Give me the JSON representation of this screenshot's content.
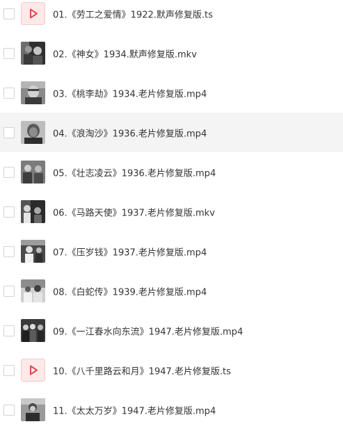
{
  "files": [
    {
      "name": "01.《劳工之爱情》1922.默声修复版.ts",
      "thumbnail": "video-play-icon"
    },
    {
      "name": "02.《神女》1934.默声修复版.mkv",
      "thumbnail": "film-still"
    },
    {
      "name": "03.《桃李劫》1934.老片修复版.mp4",
      "thumbnail": "film-still"
    },
    {
      "name": "04.《浪淘沙》1936.老片修复版.mp4",
      "thumbnail": "film-still"
    },
    {
      "name": "05.《壮志凌云》1936.老片修复版.mp4",
      "thumbnail": "film-still"
    },
    {
      "name": "06.《马路天使》1937.老片修复版.mkv",
      "thumbnail": "film-still"
    },
    {
      "name": "07.《压岁钱》1937.老片修复版.mp4",
      "thumbnail": "film-still"
    },
    {
      "name": "08.《白蛇传》1939.老片修复版.mp4",
      "thumbnail": "film-still"
    },
    {
      "name": "09.《一江春水向东流》1947.老片修复版.mp4",
      "thumbnail": "film-still"
    },
    {
      "name": "10.《八千里路云和月》1947.老片修复版.ts",
      "thumbnail": "video-play-icon"
    },
    {
      "name": "11.《太太万岁》1947.老片修复版.mp4",
      "thumbnail": "film-still"
    }
  ],
  "hovered_row": 4,
  "colors": {
    "hover_background": "#f4f4f4",
    "text": "#333333",
    "play_icon": "#e5494b",
    "play_icon_background": "#fde9e9"
  }
}
